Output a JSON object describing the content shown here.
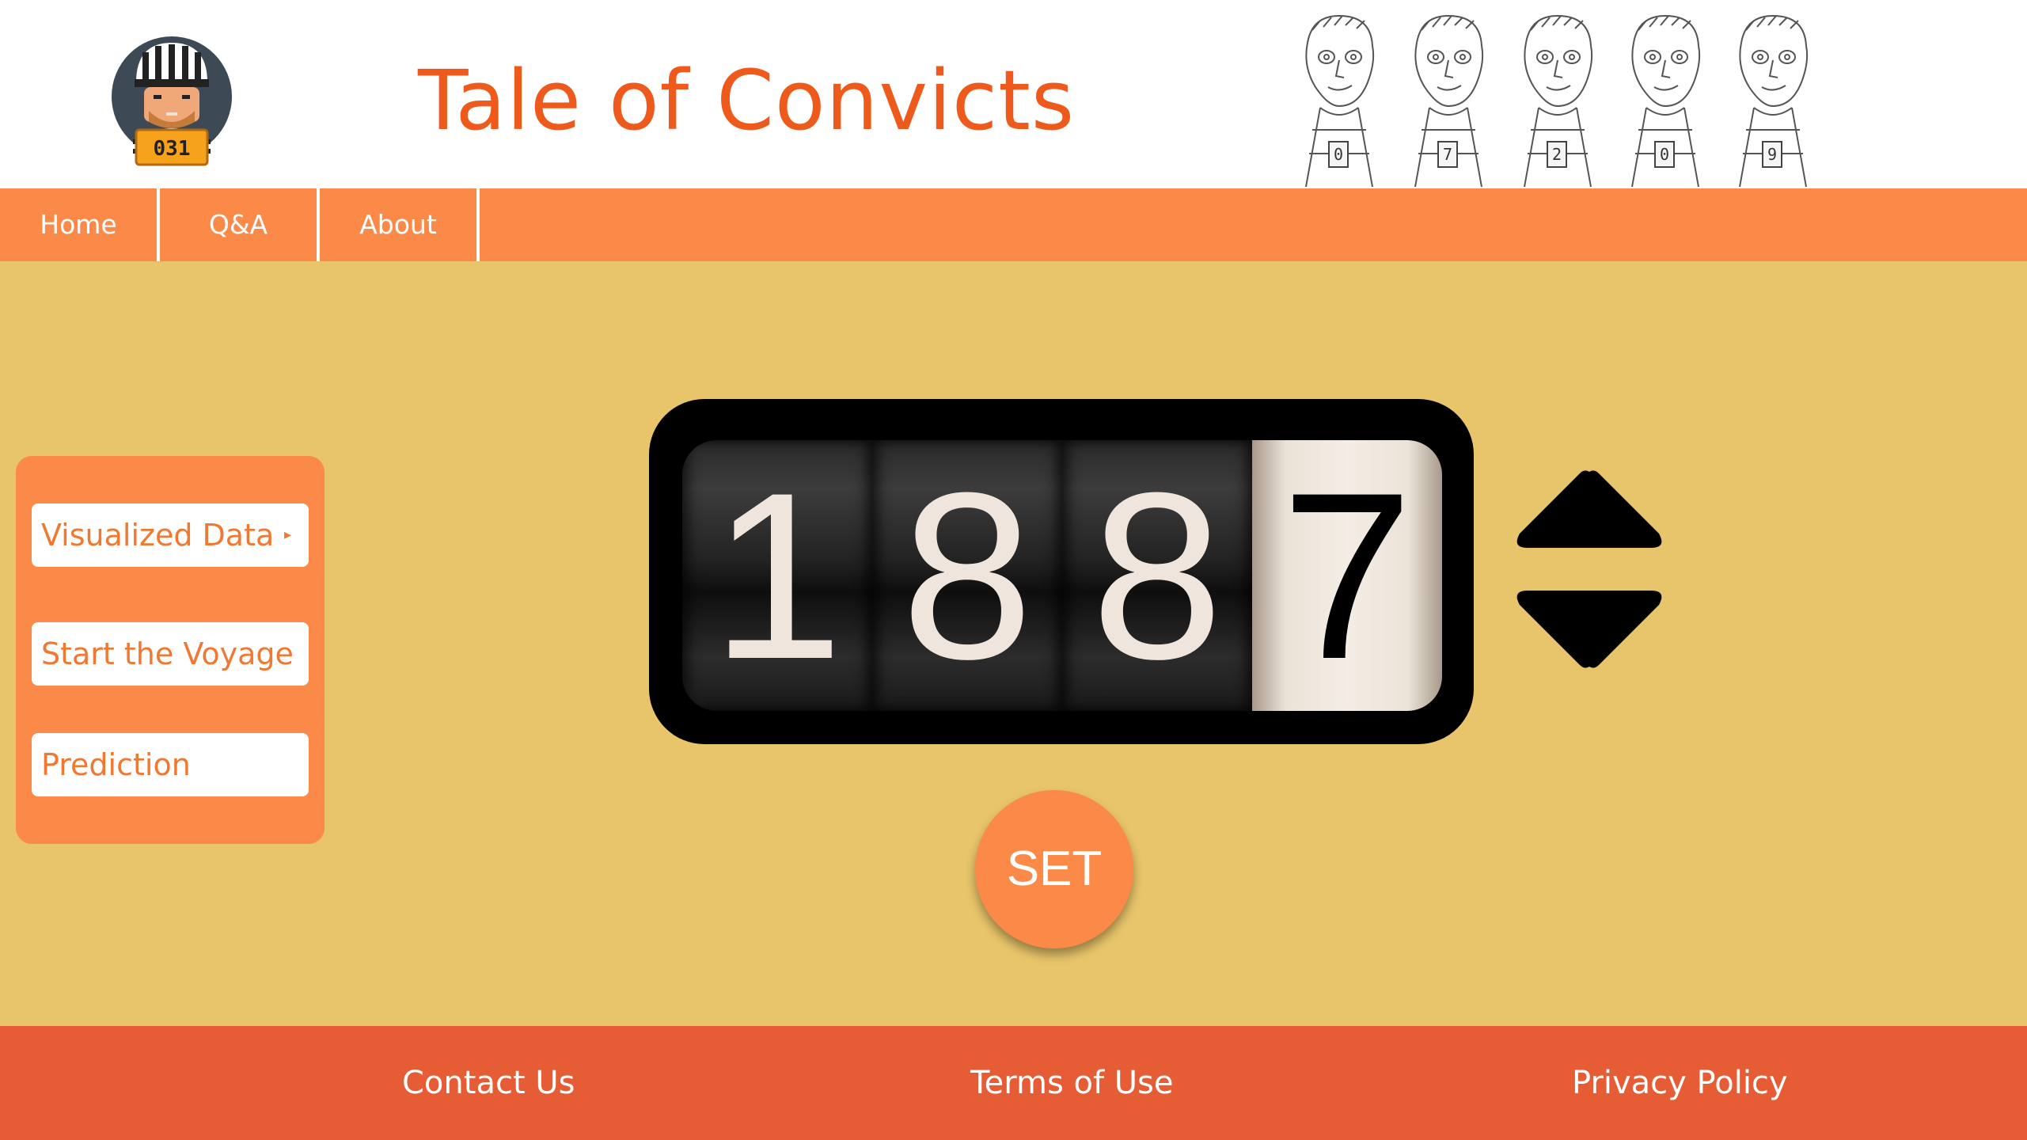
{
  "header": {
    "title": "Tale of Convicts",
    "logo": {
      "icon": "prisoner-avatar-icon",
      "badge_number": "031"
    },
    "convicts": [
      {
        "number": "0"
      },
      {
        "number": "7"
      },
      {
        "number": "2"
      },
      {
        "number": "0"
      },
      {
        "number": "9"
      }
    ]
  },
  "nav": {
    "items": [
      {
        "label": "Home"
      },
      {
        "label": "Q&A"
      },
      {
        "label": "About"
      }
    ]
  },
  "sidebar": {
    "items": [
      {
        "label": "Visualized Data",
        "caret": "▸"
      },
      {
        "label": "Start the Voyage"
      },
      {
        "label": "Prediction"
      }
    ]
  },
  "year_counter": {
    "digits": [
      "1",
      "8",
      "8",
      "7"
    ],
    "active_digit_index": 3,
    "up_icon": "triangle-up-icon",
    "down_icon": "triangle-down-icon"
  },
  "set_button": {
    "label": "SET"
  },
  "footer": {
    "links": [
      {
        "label": "Contact Us"
      },
      {
        "label": "Terms of Use"
      },
      {
        "label": "Privacy Policy"
      }
    ]
  },
  "colors": {
    "title": "#ee5a1c",
    "nav_bg": "#fb8a49",
    "page_bg": "#e8c46a",
    "footer_bg": "#e55c35",
    "sidebar_text": "#f07830"
  }
}
